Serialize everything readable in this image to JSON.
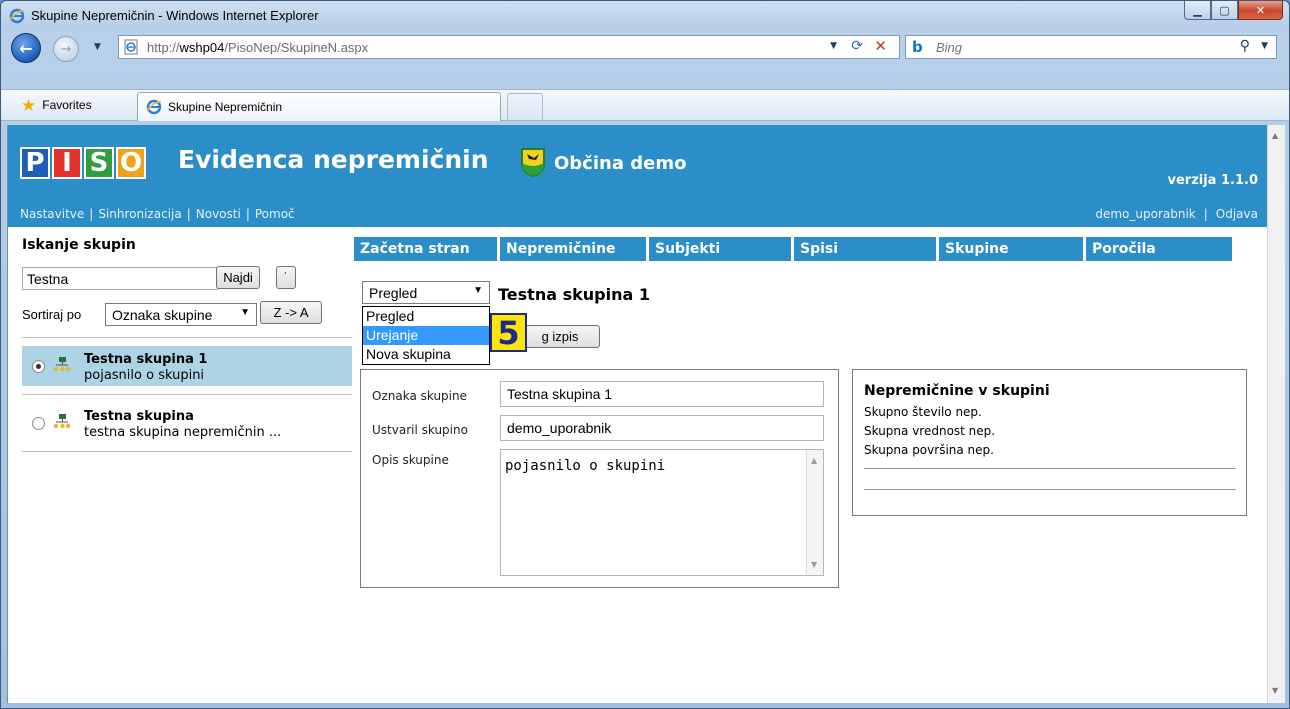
{
  "browser": {
    "window_title": "Skupine Nepremičnin - Windows Internet Explorer",
    "url_prefix": "http://",
    "url_host": "wshp04",
    "url_path": "/PisoNep/SkupineN.aspx",
    "search_placeholder": "Bing",
    "favorites_label": "Favorites",
    "tab_title": "Skupine Nepremičnin"
  },
  "header": {
    "logo_letters": [
      "P",
      "I",
      "S",
      "O"
    ],
    "logo_colors": [
      "#1f5fb5",
      "#e3332c",
      "#2e9f3c",
      "#f0a21b"
    ],
    "title": "Evidenca nepremičnin",
    "municipality": "Občina demo",
    "version": "verzija 1.1.0",
    "links": [
      "Nastavitve",
      "Sinhronizacija",
      "Novosti",
      "Pomoč"
    ],
    "user": "demo_uporabnik",
    "logout": "Odjava"
  },
  "left": {
    "title": "Iskanje skupin",
    "search_value": "Testna",
    "find_label": "Najdi",
    "more_label": "˙",
    "sort_label": "Sortiraj po",
    "sort_value": "Oznaka skupine",
    "order_label": "Z -> A",
    "groups": [
      {
        "name": "Testna skupina 1",
        "desc": "pojasnilo o skupini",
        "selected": true
      },
      {
        "name": "Testna skupina",
        "desc": "testna skupina nepremičnin ...",
        "selected": false
      }
    ]
  },
  "nav": {
    "tabs": [
      "Začetna stran",
      "Nepremičnine",
      "Subjekti",
      "Spisi",
      "Skupine",
      "Poročila"
    ]
  },
  "main": {
    "mode_value": "Pregled",
    "mode_options": [
      "Pregled",
      "Urejanje",
      "Nova skupina"
    ],
    "mode_highlighted": "Urejanje",
    "heading": "Testna skupina 1",
    "print_label": "g izpis",
    "step_badge": "5",
    "form": {
      "oznaka_label": "Oznaka skupine",
      "oznaka_value": "Testna skupina 1",
      "ustvaril_label": "Ustvaril skupino",
      "ustvaril_value": "demo_uporabnik",
      "opis_label": "Opis skupine",
      "opis_value": "pojasnilo o skupini"
    },
    "stats": {
      "title": "Nepremičnine v skupini",
      "lines": [
        "Skupno število nep.",
        "Skupna vrednost nep.",
        "Skupna površina nep."
      ]
    }
  }
}
